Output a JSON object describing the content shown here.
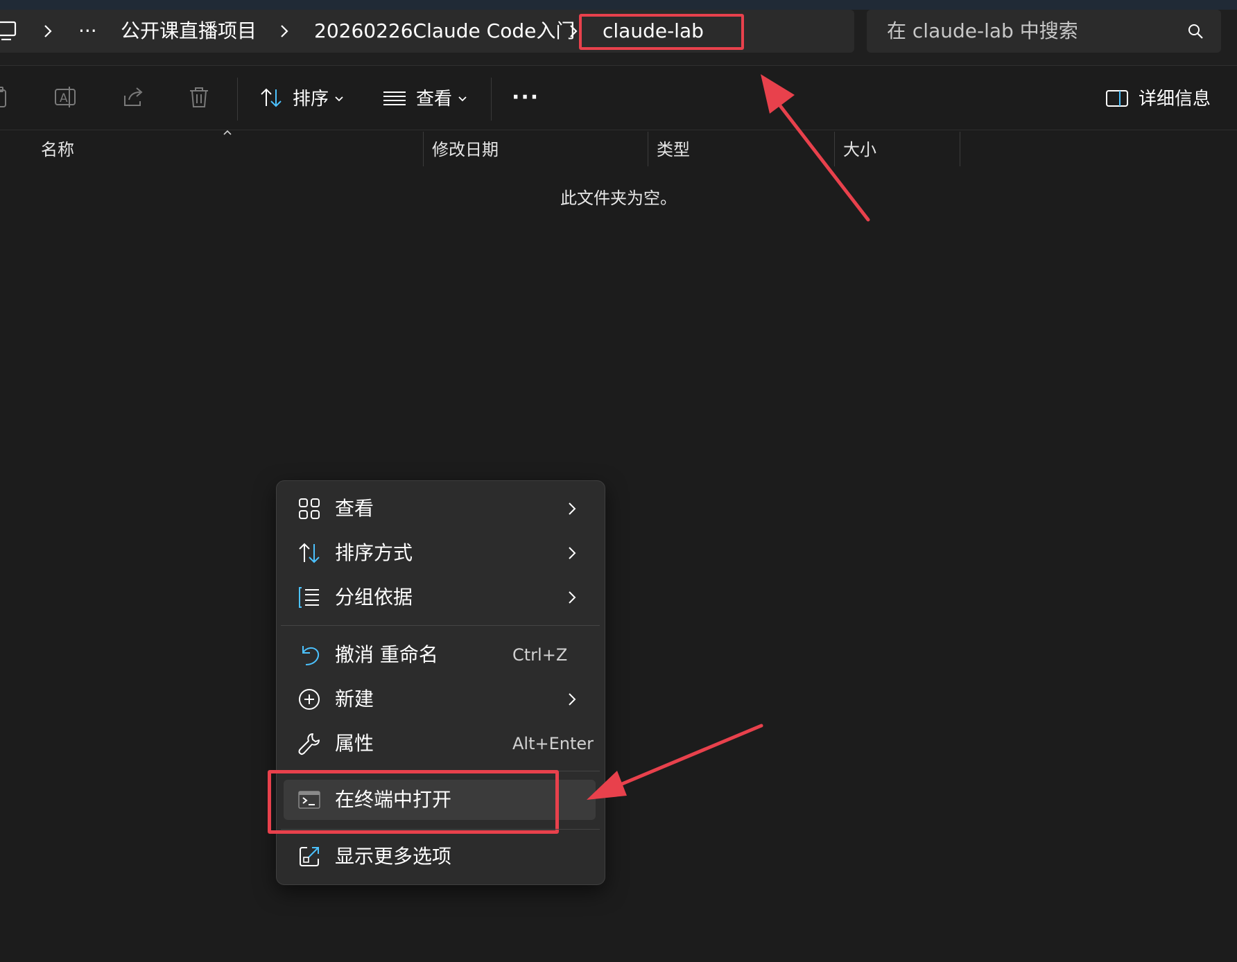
{
  "breadcrumb": {
    "overflow_label": "···",
    "items": [
      "公开课直播项目",
      "20260226Claude Code入门",
      "claude-lab"
    ]
  },
  "search": {
    "placeholder": "在 claude-lab 中搜索"
  },
  "toolbar": {
    "sort_label": "排序",
    "view_label": "查看",
    "more_label": "···",
    "details_label": "详细信息"
  },
  "columns": [
    "名称",
    "修改日期",
    "类型",
    "大小"
  ],
  "empty_message": "此文件夹为空。",
  "context_menu": {
    "items": [
      {
        "label": "查看",
        "icon": "grid-icon",
        "submenu": true
      },
      {
        "label": "排序方式",
        "icon": "sort-icon",
        "submenu": true
      },
      {
        "label": "分组依据",
        "icon": "group-list-icon",
        "submenu": true
      },
      {
        "label": "撤消 重命名",
        "icon": "undo-icon",
        "shortcut": "Ctrl+Z"
      },
      {
        "label": "新建",
        "icon": "plus-circle-icon",
        "submenu": true
      },
      {
        "label": "属性",
        "icon": "wrench-icon",
        "shortcut": "Alt+Enter"
      },
      {
        "label": "在终端中打开",
        "icon": "terminal-icon"
      },
      {
        "label": "显示更多选项",
        "icon": "share-out-icon"
      }
    ]
  },
  "colors": {
    "background": "#1c1c1c",
    "menu_bg": "#2c2c2c",
    "highlight_red": "#e8414c",
    "accent_blue": "#4cc2ff"
  }
}
